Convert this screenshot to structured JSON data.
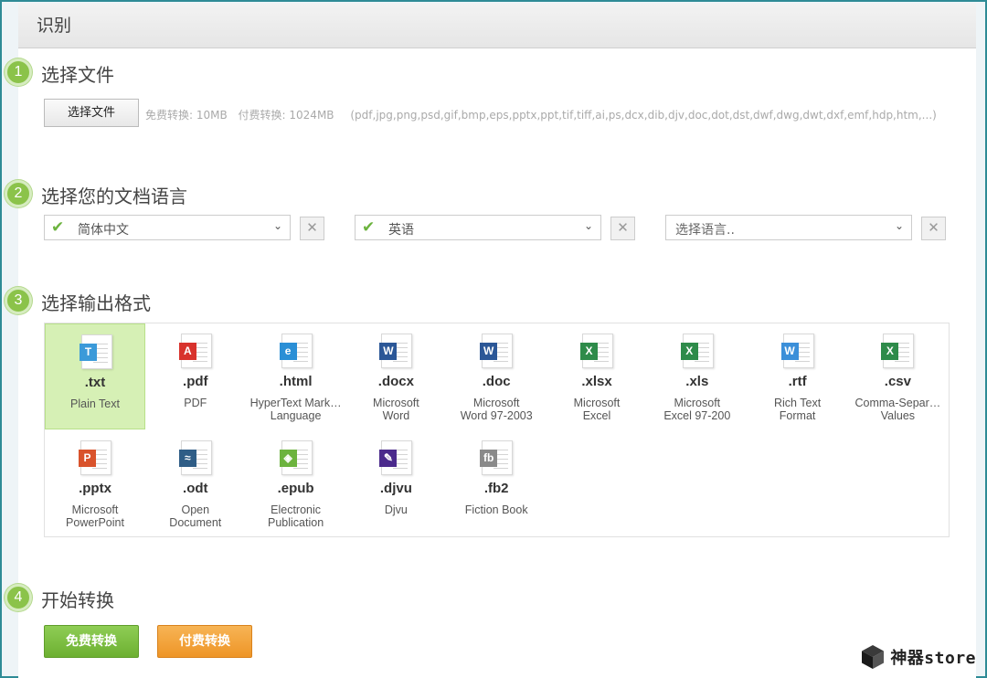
{
  "header": {
    "title": "识别"
  },
  "steps": [
    {
      "number": "1",
      "title": "选择文件"
    },
    {
      "number": "2",
      "title": "选择您的文档语言"
    },
    {
      "number": "3",
      "title": "选择输出格式"
    },
    {
      "number": "4",
      "title": "开始转换"
    }
  ],
  "file": {
    "button_label": "选择文件",
    "free_limit": "免费转换: 10MB",
    "paid_limit": "付费转换: 1024MB",
    "supported_types": "(pdf,jpg,png,psd,gif,bmp,eps,pptx,ppt,tif,tiff,ai,ps,dcx,dib,djv,doc,dot,dst,dwf,dwg,dwt,dxf,emf,hdp,htm,...)"
  },
  "languages": [
    {
      "value": "简体中文",
      "placeholder": "",
      "checked": true,
      "remove": "✕"
    },
    {
      "value": "英语",
      "placeholder": "",
      "checked": true,
      "remove": "✕"
    },
    {
      "value": "",
      "placeholder": "选择语言..",
      "checked": false,
      "remove": "✕"
    }
  ],
  "formats": [
    {
      "ext": ".txt",
      "desc1": "Plain Text",
      "desc2": "",
      "icon": "txt-file-icon",
      "badge": "T",
      "color": "#3b9ad9",
      "selected": true
    },
    {
      "ext": ".pdf",
      "desc1": "PDF",
      "desc2": "",
      "icon": "pdf-file-icon",
      "badge": "A",
      "color": "#d8322c",
      "selected": false
    },
    {
      "ext": ".html",
      "desc1": "HyperText Mark…",
      "desc2": "Language",
      "icon": "html-file-icon",
      "badge": "e",
      "color": "#2a8fd6",
      "selected": false
    },
    {
      "ext": ".docx",
      "desc1": "Microsoft",
      "desc2": "Word",
      "icon": "word-file-icon",
      "badge": "W",
      "color": "#2b5797",
      "selected": false
    },
    {
      "ext": ".doc",
      "desc1": "Microsoft",
      "desc2": "Word 97-2003",
      "icon": "word-file-icon",
      "badge": "W",
      "color": "#2b5797",
      "selected": false
    },
    {
      "ext": ".xlsx",
      "desc1": "Microsoft",
      "desc2": "Excel",
      "icon": "excel-file-icon",
      "badge": "X",
      "color": "#2e8b4a",
      "selected": false
    },
    {
      "ext": ".xls",
      "desc1": "Microsoft",
      "desc2": "Excel 97-200",
      "icon": "excel-file-icon",
      "badge": "X",
      "color": "#2e8b4a",
      "selected": false
    },
    {
      "ext": ".rtf",
      "desc1": "Rich Text",
      "desc2": "Format",
      "icon": "rtf-file-icon",
      "badge": "W",
      "color": "#3b8fd9",
      "selected": false
    },
    {
      "ext": ".csv",
      "desc1": "Comma-Separ…",
      "desc2": "Values",
      "icon": "csv-file-icon",
      "badge": "X",
      "color": "#2e8b4a",
      "selected": false
    },
    {
      "ext": ".pptx",
      "desc1": "Microsoft",
      "desc2": "PowerPoint",
      "icon": "powerpoint-file-icon",
      "badge": "P",
      "color": "#d9532c",
      "selected": false
    },
    {
      "ext": ".odt",
      "desc1": "Open",
      "desc2": "Document",
      "icon": "odt-file-icon",
      "badge": "≈",
      "color": "#2f5d86",
      "selected": false
    },
    {
      "ext": ".epub",
      "desc1": "Electronic",
      "desc2": "Publication",
      "icon": "epub-file-icon",
      "badge": "◈",
      "color": "#6cb33e",
      "selected": false
    },
    {
      "ext": ".djvu",
      "desc1": "Djvu",
      "desc2": "",
      "icon": "djvu-file-icon",
      "badge": "✎",
      "color": "#4b2a8c",
      "selected": false
    },
    {
      "ext": ".fb2",
      "desc1": "Fiction Book",
      "desc2": "",
      "icon": "fb2-file-icon",
      "badge": "fb",
      "color": "#8a8a8a",
      "selected": false
    }
  ],
  "actions": {
    "free_label": "免费转换",
    "paid_label": "付费转换"
  },
  "brand": {
    "text": "神器store"
  },
  "colors": {
    "accent_green": "#8bc34a",
    "accent_orange": "#ee9527",
    "frame": "#2e8b96"
  }
}
